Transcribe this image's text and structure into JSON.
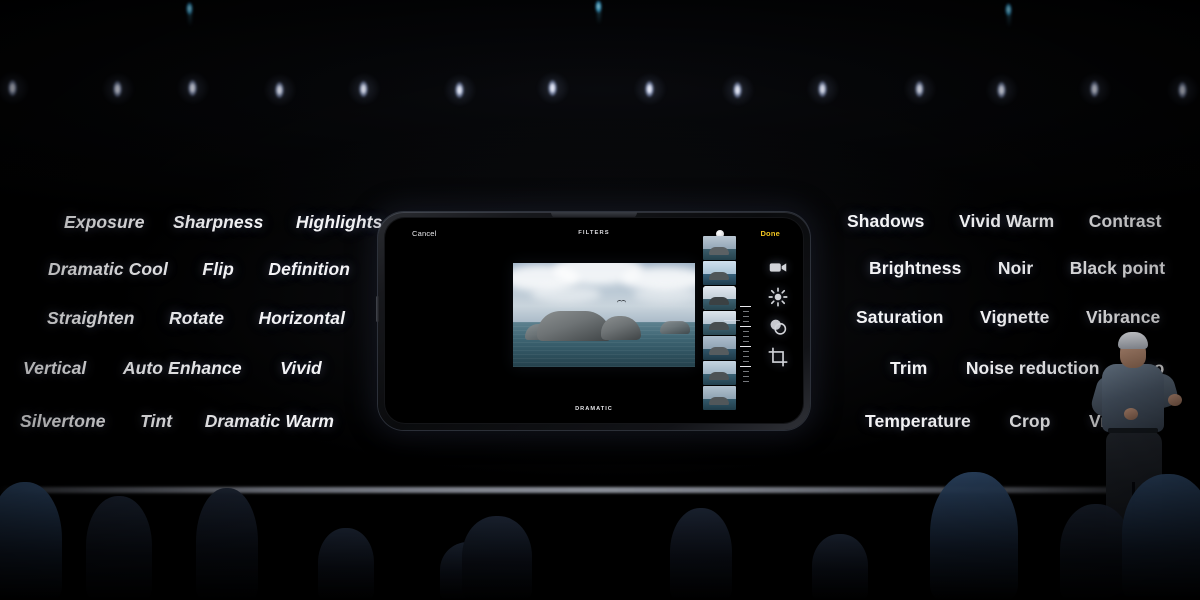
{
  "scene": {
    "title": "Keynote stage slide — Photos editing capabilities",
    "background_color": "#000000"
  },
  "stage": {
    "spotlights_white_count": 14,
    "spotlights_blue_count": 3,
    "stage_edge_label": "stage-edge-highlight"
  },
  "left_column": {
    "rows": [
      {
        "items": [
          "Exposure",
          "Sharpness",
          "Highlights"
        ]
      },
      {
        "items": [
          "Dramatic Cool",
          "Flip",
          "Definition"
        ]
      },
      {
        "items": [
          "Straighten",
          "Rotate",
          "Horizontal"
        ]
      },
      {
        "items": [
          "Vertical",
          "Auto Enhance",
          "Vivid"
        ]
      },
      {
        "items": [
          "Silvertone",
          "Tint",
          "Dramatic Warm"
        ]
      }
    ]
  },
  "right_column": {
    "rows": [
      {
        "items": [
          "Shadows",
          "Vivid Warm",
          "Contrast"
        ]
      },
      {
        "items": [
          "Brightness",
          "Noir",
          "Black point"
        ]
      },
      {
        "items": [
          "Saturation",
          "Vignette",
          "Vibrance"
        ]
      },
      {
        "items": [
          "Trim",
          "Noise reduction",
          "mo"
        ]
      },
      {
        "items": [
          "Temperature",
          "Crop",
          "Vivid"
        ]
      }
    ]
  },
  "device": {
    "orientation": "landscape",
    "topbar": {
      "cancel_label": "Cancel",
      "title": "FILTERS",
      "done_label": "Done",
      "done_color": "#f0c420"
    },
    "filter_name": "DRAMATIC",
    "tools": [
      {
        "name": "video-icon"
      },
      {
        "name": "adjust-sun-icon"
      },
      {
        "name": "filters-icon"
      },
      {
        "name": "crop-icon"
      }
    ],
    "thumbnail_count": 7,
    "selected_thumbnail_index": 2,
    "photo": {
      "subject": "rock formations in the sea under a cloudy sky with a bird"
    }
  },
  "presenter": {
    "name": "presenter-silhouette",
    "hair_color": "#e8eaef",
    "shirt_color": "#4a5767"
  },
  "audience": {
    "silhouette_count": 11
  }
}
